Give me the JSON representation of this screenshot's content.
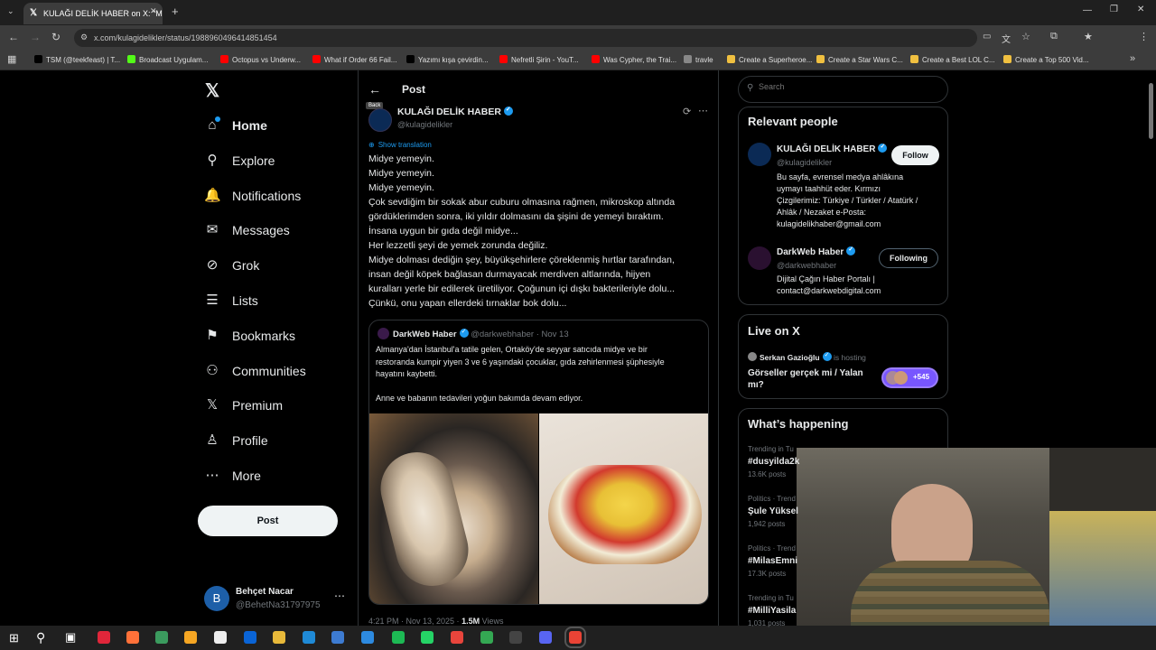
{
  "browser": {
    "tab_title": "KULAĞI DELİK HABER on X: \"Mi",
    "url": "x.com/kulagidelikler/status/1988960496414851454",
    "bookmarks": [
      {
        "label": "TSM (@teekfeast) | T...",
        "color": "#000000"
      },
      {
        "label": "Broadcast Uygulam...",
        "color": "#53fc18"
      },
      {
        "label": "Octopus vs Underw...",
        "color": "#ff0000"
      },
      {
        "label": "What if Order 66 Fail...",
        "color": "#ff0000"
      },
      {
        "label": "Yazımı kışa çevirdin...",
        "color": "#000000"
      },
      {
        "label": "Nefretli Şirin - YouT...",
        "color": "#ff0000"
      },
      {
        "label": "Was Cypher, the Trai...",
        "color": "#ff0000"
      },
      {
        "label": "travle",
        "color": "#888888"
      },
      {
        "label": "Create a Superheroe...",
        "color": "#f0c040"
      },
      {
        "label": "Create a Star Wars C...",
        "color": "#f0c040"
      },
      {
        "label": "Create a Best LOL C...",
        "color": "#f0c040"
      },
      {
        "label": "Create a Top 500 Vid...",
        "color": "#f0c040"
      }
    ],
    "profile_initial": "M"
  },
  "nav": {
    "items": [
      {
        "label": "Home",
        "icon": "home-icon",
        "glyph": "⌂"
      },
      {
        "label": "Explore",
        "icon": "search-icon",
        "glyph": "⚲"
      },
      {
        "label": "Notifications",
        "icon": "bell-icon",
        "glyph": "🔔"
      },
      {
        "label": "Messages",
        "icon": "mail-icon",
        "glyph": "✉"
      },
      {
        "label": "Grok",
        "icon": "grok-icon",
        "glyph": "⊘"
      },
      {
        "label": "Lists",
        "icon": "list-icon",
        "glyph": "☰"
      },
      {
        "label": "Bookmarks",
        "icon": "bookmark-icon",
        "glyph": "⚑"
      },
      {
        "label": "Communities",
        "icon": "communities-icon",
        "glyph": "⚇"
      },
      {
        "label": "Premium",
        "icon": "x-icon",
        "glyph": "𝕏"
      },
      {
        "label": "Profile",
        "icon": "person-icon",
        "glyph": "♙"
      },
      {
        "label": "More",
        "icon": "more-icon",
        "glyph": "⋯"
      }
    ],
    "post_label": "Post",
    "account": {
      "name": "Behçet Nacar",
      "handle": "@BehetNa31797975",
      "initial": "B"
    }
  },
  "post": {
    "header_title": "Post",
    "back_tooltip": "Back",
    "author_name": "KULAĞI DELİK HABER",
    "author_handle": "@kulagidelikler",
    "show_translation": "Show translation",
    "lines": [
      "Midye yemeyin.",
      "Midye yemeyin.",
      "Midye yemeyin.",
      "Çok sevdiğim bir sokak abur cuburu olmasına rağmen, mikroskop altında",
      "gördüklerimden sonra, iki yıldır dolmasını da şişini de yemeyi bıraktım.",
      "İnsana uygun bir gıda değil midye...",
      "Her lezzetli şeyi de yemek zorunda değiliz.",
      "Midye dolması dediğin şey, büyükşehirlere çöreklenmiş hırtlar tarafından,",
      "insan değil köpek bağlasan durmayacak merdiven altlarında, hijyen",
      "kuralları yerle bir edilerek üretiliyor. Çoğunun içi dışkı bakterileriyle dolu...",
      "Çünkü, onu yapan ellerdeki tırnaklar bok dolu..."
    ],
    "quote": {
      "name": "DarkWeb Haber",
      "handle": "@darkwebhaber",
      "date": "· Nov 13",
      "lines": [
        "Almanya'dan İstanbul'a tatile gelen, Ortaköy'de seyyar satıcıda midye ve bir",
        "restoranda kumpir yiyen 3 ve 6 yaşındaki çocuklar, gıda zehirlenmesi şüphesiyle",
        "hayatını kaybetti.",
        "",
        "Anne ve babanın tedavileri yoğun bakımda devam ediyor."
      ]
    },
    "timestamp": "4:21 PM · Nov 13, 2025 ·",
    "views_count": "1.5M",
    "views_label": "Views"
  },
  "sidebar": {
    "search_placeholder": "Search",
    "relevant_title": "Relevant people",
    "people": [
      {
        "name": "KULAĞI DELİK HABER",
        "handle": "@kulagidelikler",
        "button": "Follow",
        "bio": [
          "Bu sayfa, evrensel medya ahlâkına",
          "uymayı taahhüt eder. Kırmızı",
          "Çizgilerimiz: Türkiye / Türkler / Atatürk /",
          "Ahlâk / Nezaket e-Posta:",
          "kulagidelikhaber@gmail.com"
        ]
      },
      {
        "name": "DarkWeb Haber",
        "handle": "@darkwebhaber",
        "button": "Following",
        "bio": [
          "Dijital Çağın Haber Portalı |",
          "contact@darkwebdigital.com"
        ]
      }
    ],
    "live_title": "Live on X",
    "live": {
      "host": "Serkan Gazioğlu",
      "hosting": "is hosting",
      "title_line1": "Görseller gerçek mi / Yalan",
      "title_line2": "mı?",
      "listeners": "+545"
    },
    "happening_title": "What’s happening",
    "trends": [
      {
        "category": "Trending in Tu",
        "tag": "#dusyilda2k",
        "count": "13.6K posts"
      },
      {
        "category": "Politics · Trend",
        "tag": "Şule Yüksel",
        "count": "1,942 posts"
      },
      {
        "category": "Politics · Trend",
        "tag": "#MilasEmni",
        "count": "17.3K posts"
      },
      {
        "category": "Trending in Tu",
        "tag": "#MilliYasila",
        "count": "1,031 posts"
      }
    ]
  },
  "colors": {
    "accent": "#1d9bf0",
    "background": "#000000",
    "border": "#2f3336",
    "muted": "#71767b"
  }
}
